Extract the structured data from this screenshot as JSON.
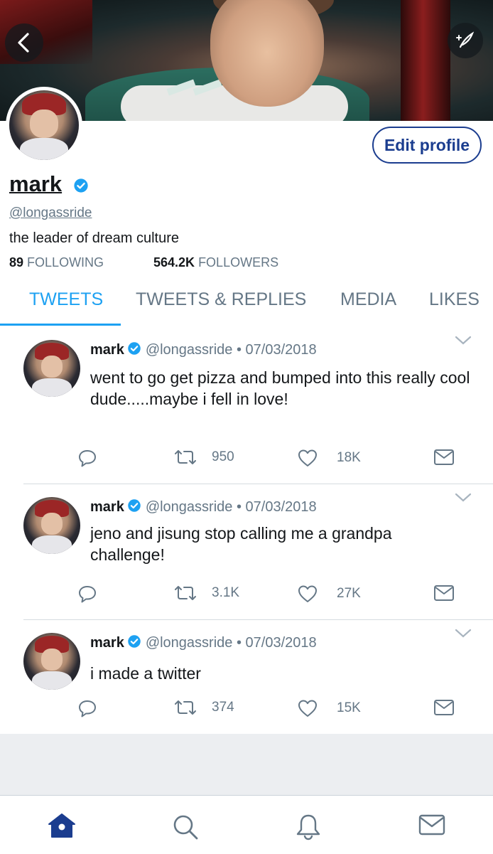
{
  "header": {
    "edit_profile_label": "Edit profile"
  },
  "profile": {
    "name": "mark",
    "handle": "@longassride",
    "bio": "the leader of dream culture",
    "following_count": "89",
    "following_label": "FOLLOWING",
    "followers_count": "564.2K",
    "followers_label": "FOLLOWERS"
  },
  "tabs": [
    {
      "label": "TWEETS",
      "active": true
    },
    {
      "label": "TWEETS & REPLIES",
      "active": false
    },
    {
      "label": "MEDIA",
      "active": false
    },
    {
      "label": "LIKES",
      "active": false
    }
  ],
  "tweets": [
    {
      "name": "mark",
      "handle": "@longassride",
      "sep": "•",
      "date": "07/03/2018",
      "text": "went to go get pizza and bumped into this really cool dude.....maybe i fell in love!",
      "retweets": "950",
      "likes": "18K"
    },
    {
      "name": "mark",
      "handle": "@longassride",
      "sep": "•",
      "date": "07/03/2018",
      "text": "jeno and jisung stop calling me a grandpa challenge!",
      "retweets": "3.1K",
      "likes": "27K"
    },
    {
      "name": "mark",
      "handle": "@longassride",
      "sep": "•",
      "date": "07/03/2018",
      "text": "i made a twitter",
      "retweets": "374",
      "likes": "15K"
    }
  ],
  "colors": {
    "accent": "#1da1f2",
    "edit_button": "#1b3d8f",
    "secondary_text": "#657786"
  },
  "icons": {
    "back": "back-arrow-icon",
    "compose": "compose-feather-icon",
    "verified": "verified-badge-icon",
    "reply": "reply-icon",
    "retweet": "retweet-icon",
    "like": "heart-icon",
    "dm": "envelope-icon",
    "chevron": "chevron-down-icon",
    "home": "home-icon",
    "search": "search-icon",
    "notifications": "bell-icon",
    "messages": "envelope-icon"
  }
}
